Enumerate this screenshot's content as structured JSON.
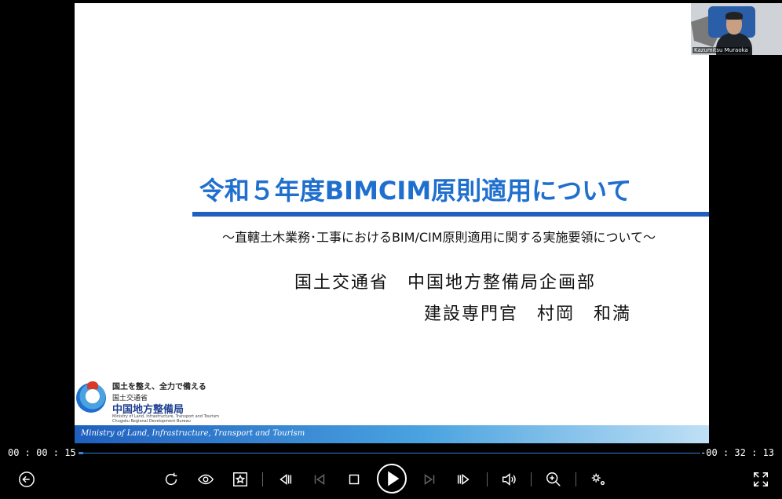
{
  "slide": {
    "title": "令和５年度BIMCIM原則適用について",
    "subtitle": "～直轄土木業務･工事におけるBIM/CIM原則適用に関する実施要領について～",
    "org_line1": "国土交通省　中国地方整備局企画部",
    "org_line2": "建設専門官　村岡　和満",
    "logo": {
      "slogan": "国土を整え、全力で備える",
      "ministry": "国土交通省",
      "bureau": "中国地方整備局",
      "en_line1": "Ministry of Land, Infrastructure, Transport and Tourism",
      "en_line2": "Chugoku Regional Development Bureau"
    },
    "footer_text": "Ministry of Land, Infrastructure, Transport and Tourism"
  },
  "webcam": {
    "name": "Kazumitsu Muraoka"
  },
  "player": {
    "elapsed": "00 : 00 : 15",
    "remaining": "-00 : 32 : 13",
    "progress": 0.008,
    "accent_color": "#3b7fd6"
  },
  "controls": [
    "back-icon",
    "rotate-icon",
    "eye-icon",
    "star-icon",
    "step-back-icon",
    "skip-start-icon",
    "stop-icon",
    "play-icon",
    "skip-end-icon",
    "step-forward-icon",
    "volume-icon",
    "zoom-in-icon",
    "settings-icon",
    "fullscreen-icon"
  ]
}
